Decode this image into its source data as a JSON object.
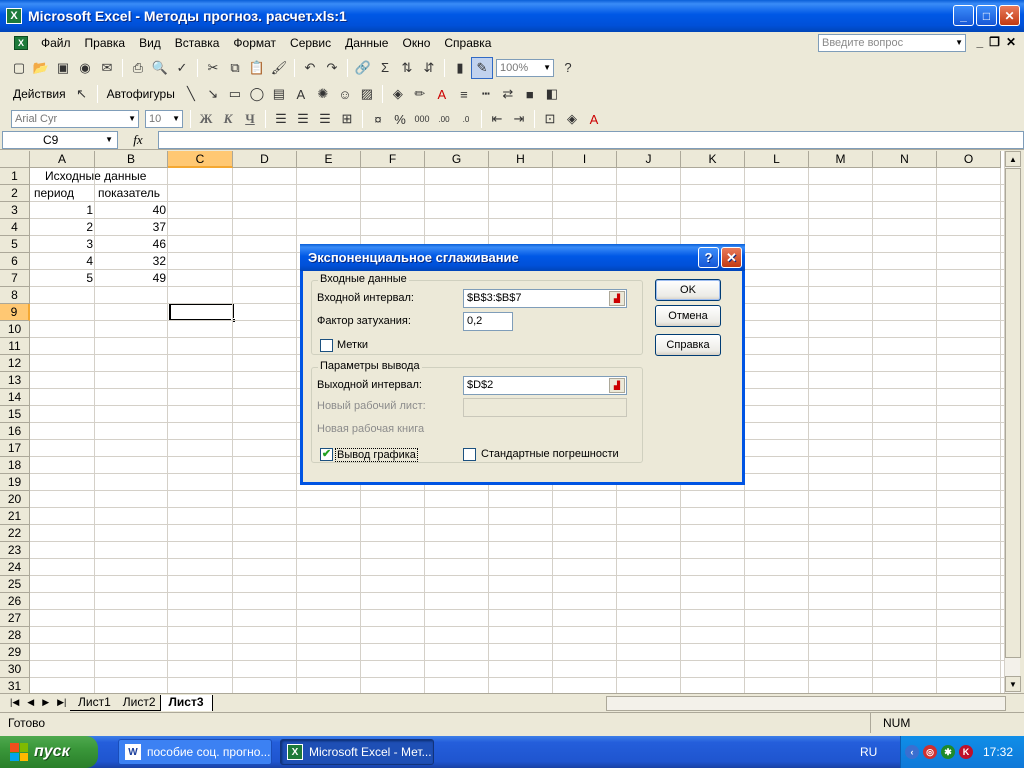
{
  "window": {
    "title": "Microsoft Excel - Методы прогноз. расчет.xls:1"
  },
  "menu": {
    "items": [
      "Файл",
      "Правка",
      "Вид",
      "Вставка",
      "Формат",
      "Сервис",
      "Данные",
      "Окно",
      "Справка"
    ],
    "ask_placeholder": "Введите вопрос"
  },
  "toolbar": {
    "zoom": "100%",
    "actions_label": "Действия",
    "autoshapes_label": "Автофигуры",
    "font_name": "Arial Cyr",
    "font_size": "10",
    "bold": "Ж",
    "italic": "К",
    "underline": "Ч"
  },
  "formula": {
    "name_box": "C9",
    "fx": "fx"
  },
  "grid": {
    "columns": [
      "A",
      "B",
      "C",
      "D",
      "E",
      "F",
      "G",
      "H",
      "I",
      "J",
      "K",
      "L",
      "M",
      "N",
      "O"
    ],
    "selected_column": "C",
    "selected_row": 9,
    "rows": [
      "1",
      "2",
      "3",
      "4",
      "5",
      "6",
      "7",
      "8",
      "9",
      "10",
      "11",
      "12",
      "13",
      "14",
      "15",
      "16",
      "17",
      "18",
      "19",
      "20",
      "21",
      "22",
      "23",
      "24",
      "25",
      "26",
      "27",
      "28",
      "29",
      "30",
      "31"
    ],
    "cells": {
      "title": "Исходные данные",
      "header_period": "период",
      "header_value": "показатель",
      "periods": [
        "1",
        "2",
        "3",
        "4",
        "5"
      ],
      "values": [
        "40",
        "37",
        "46",
        "32",
        "49"
      ]
    }
  },
  "sheets": {
    "tabs": [
      "Лист1",
      "Лист2",
      "Лист3"
    ],
    "active": "Лист3"
  },
  "status": {
    "ready": "Готово",
    "num": "NUM"
  },
  "dialog": {
    "title": "Экспоненциальное сглаживание",
    "input_group": "Входные данные",
    "input_range_label": "Входной интервал:",
    "input_range_value": "$B$3:$B$7",
    "damping_label": "Фактор затухания:",
    "damping_value": "0,2",
    "labels_label": "Метки",
    "labels_checked": false,
    "output_group": "Параметры вывода",
    "output_range_label": "Выходной интервал:",
    "output_range_value": "$D$2",
    "new_sheet_label": "Новый рабочий лист:",
    "new_book_label": "Новая рабочая книга",
    "chart_output_label": "Вывод графика",
    "chart_output_checked": true,
    "std_errors_label": "Стандартные погрешности",
    "std_errors_checked": false,
    "ok": "OK",
    "cancel": "Отмена",
    "help": "Справка"
  },
  "taskbar": {
    "start": "пуск",
    "buttons": [
      "пособие соц. прогно...",
      "Microsoft Excel - Мет..."
    ],
    "lang": "RU",
    "clock": "17:32"
  }
}
